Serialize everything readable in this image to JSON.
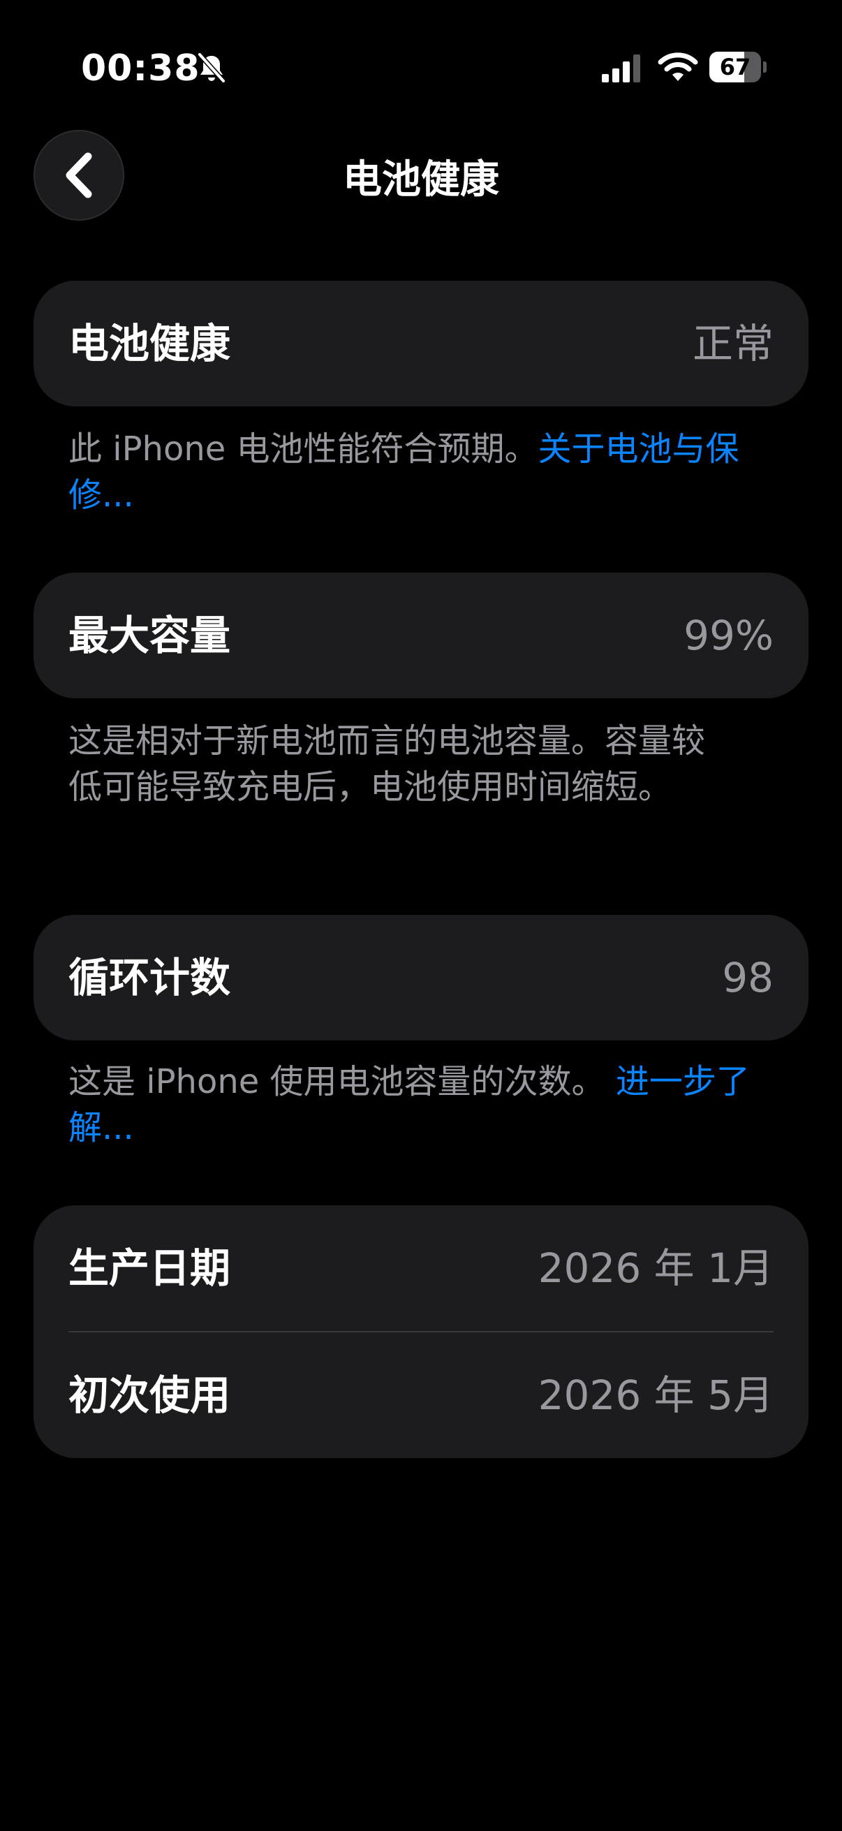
{
  "status_bar": {
    "time": "00:38",
    "battery_level": "67",
    "battery_fraction": 0.67,
    "icons": [
      "bell-slash-icon",
      "cellular-signal-icon",
      "wifi-icon",
      "battery-icon"
    ]
  },
  "nav": {
    "title": "电池健康",
    "back_icon": "chevron-left-icon"
  },
  "battery_health": {
    "label": "电池健康",
    "value": "正常",
    "footnote": "此 iPhone 电池性能符合预期。",
    "link": "关于电池与保修..."
  },
  "max_capacity": {
    "label": "最大容量",
    "value": "99%",
    "footnote": "这是相对于新电池而言的电池容量。容量较低可能导致充电后，电池使用时间缩短。"
  },
  "cycle_count": {
    "label": "循环计数",
    "value": "98",
    "footnote": "这是 iPhone 使用电池容量的次数。 ",
    "link": "进一步了解..."
  },
  "dates": {
    "manufacture_label": "生产日期",
    "manufacture_value": "2026 年 1月",
    "first_use_label": "初次使用",
    "first_use_value": "2026 年 5月"
  },
  "colors": {
    "background": "#000000",
    "card": "#1c1c1e",
    "secondary_text": "#98989f",
    "link": "#0a84ff"
  }
}
